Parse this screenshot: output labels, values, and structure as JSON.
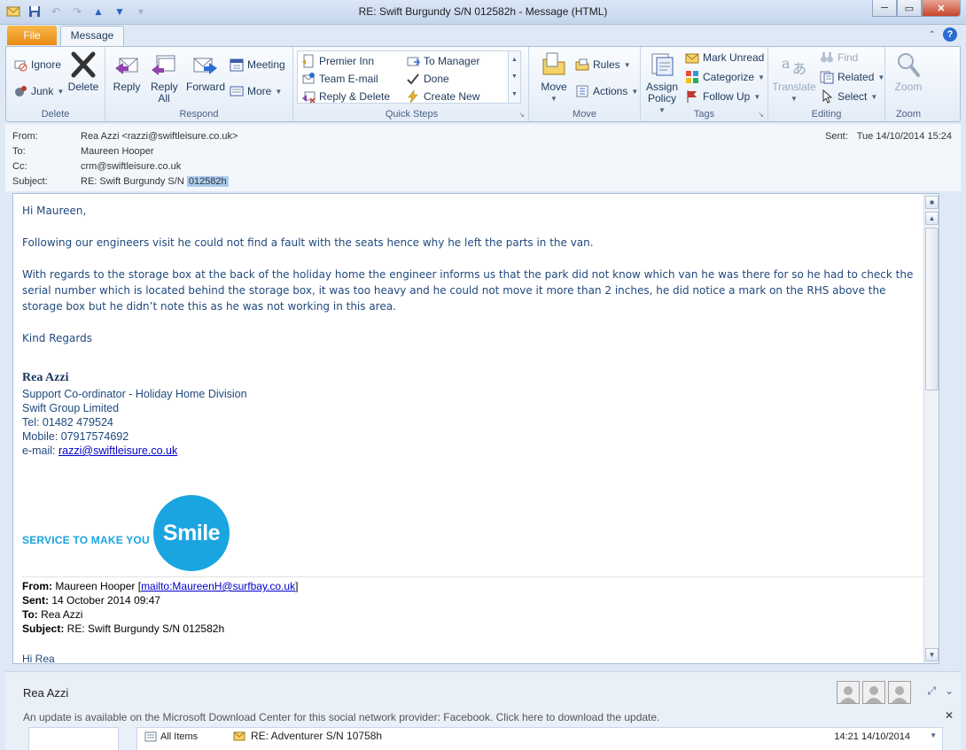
{
  "window": {
    "title": "RE: Swift Burgundy S/N  012582h  -  Message (HTML)",
    "minimize": "─",
    "restore": "▭",
    "close": "✕"
  },
  "tabs": {
    "file": "File",
    "message": "Message"
  },
  "ribbon": {
    "delete_group": {
      "label": "Delete",
      "ignore": "Ignore",
      "junk": "Junk",
      "delete": "Delete"
    },
    "respond_group": {
      "label": "Respond",
      "reply": "Reply",
      "reply_all": "Reply All",
      "forward": "Forward",
      "meeting": "Meeting",
      "more": "More"
    },
    "quicksteps_group": {
      "label": "Quick Steps",
      "premier_inn": "Premier Inn",
      "team_email": "Team E-mail",
      "reply_delete": "Reply & Delete",
      "to_manager": "To Manager",
      "done": "Done",
      "create_new": "Create New"
    },
    "move_group": {
      "label": "Move",
      "move": "Move",
      "rules": "Rules",
      "actions": "Actions"
    },
    "tags_group": {
      "label": "Tags",
      "assign_policy": "Assign Policy",
      "mark_unread": "Mark Unread",
      "categorize": "Categorize",
      "follow_up": "Follow Up"
    },
    "editing_group": {
      "label": "Editing",
      "translate": "Translate",
      "find": "Find",
      "related": "Related",
      "select": "Select"
    },
    "zoom_group": {
      "label": "Zoom",
      "zoom": "Zoom"
    }
  },
  "header": {
    "from_label": "From:",
    "from": "Rea Azzi <razzi@swiftleisure.co.uk>",
    "to_label": "To:",
    "to": "Maureen Hooper",
    "cc_label": "Cc:",
    "cc": "crm@swiftleisure.co.uk",
    "subject_label": "Subject:",
    "subject": "RE: Swift Burgundy S/N ",
    "subject_highlight": "012582h",
    "sent_label": "Sent:",
    "sent": "Tue 14/10/2014 15:24"
  },
  "body": {
    "greeting": "Hi Maureen,",
    "para1": "Following our engineers visit he could not find a fault with the seats hence why he left the parts in the van.",
    "para2": "With regards to the storage box at the back of the holiday home the engineer informs us that the park did not know which van he was there for so he had to check the serial number which is located behind the storage box, it was too heavy and he could not move it more than 2 inches, he did notice a mark on the RHS above the storage box but he didn’t note this as he was not working in this area.",
    "closing": "Kind Regards",
    "signature": {
      "name": "Rea Azzi",
      "title": "Support Co-ordinator - Holiday Home Division",
      "company": "Swift Group Limited",
      "tel": "Tel: 01482 479524",
      "mobile": "Mobile: 07917574692",
      "email_label": "e-mail: ",
      "email": "razzi@swiftleisure.co.uk"
    },
    "banner": {
      "tagline": "SERVICE TO MAKE YOU",
      "smile": "Smile"
    },
    "quoted": {
      "from_label": "From:",
      "from": " Maureen Hooper [",
      "from_link": "mailto:MaureenH@surfbay.co.uk",
      "from_end": "]",
      "sent_label": "Sent:",
      "sent": " 14 October 2014 09:47",
      "to_label": "To:",
      "to": " Rea Azzi",
      "subject_label": "Subject:",
      "subject": " RE: Swift Burgundy S/N 012582h",
      "greeting": "Hi Rea"
    }
  },
  "people": {
    "name": "Rea Azzi",
    "update_notice": "An update is available on the Microsoft Download Center for this social network provider: Facebook. Click here to download the update.",
    "close": "✕",
    "feed_filter": "All Items",
    "feed_item": "RE: Adventurer S/N 10758h",
    "feed_time": "14:21  14/10/2014"
  },
  "colors": {
    "file_tab": "#e98a14",
    "link": "#0000cc",
    "body_text": "#1f497d",
    "smile_blue": "#1aa5e0"
  }
}
